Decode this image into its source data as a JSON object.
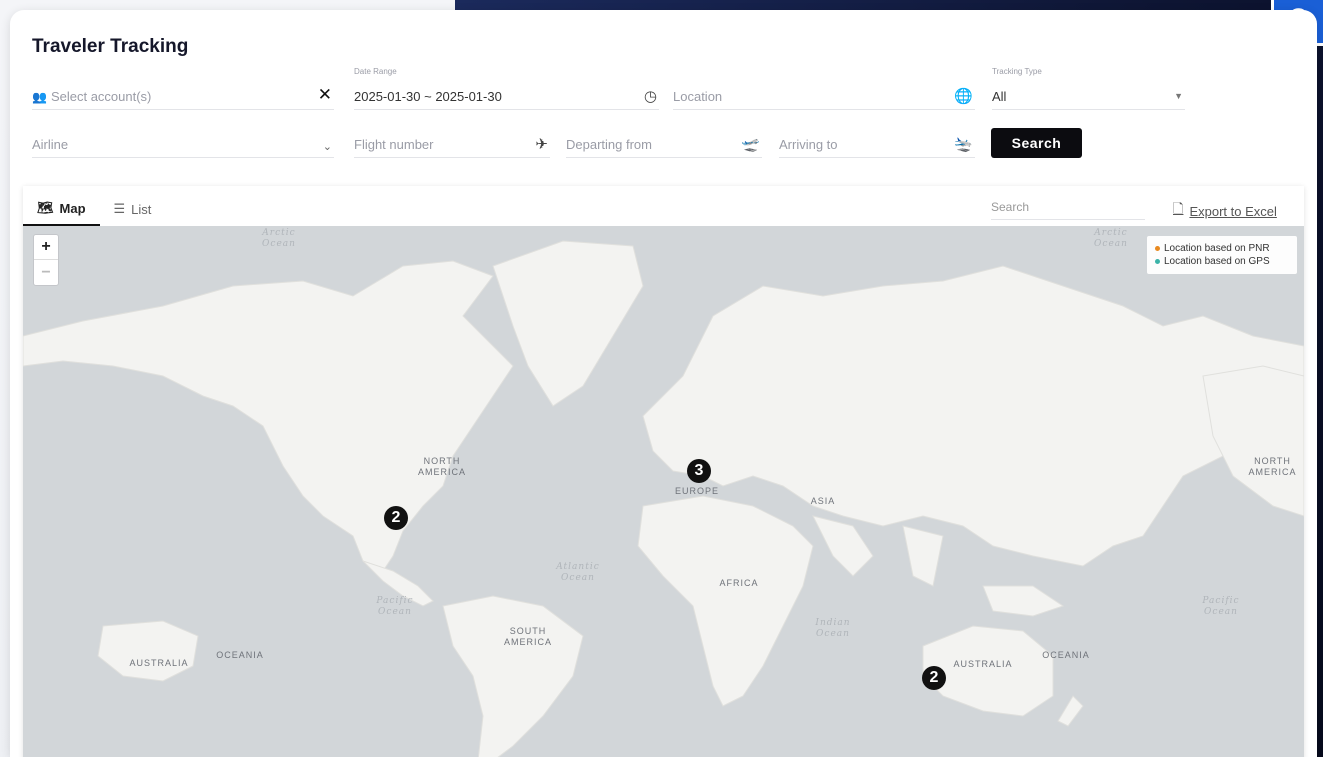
{
  "badge": "2",
  "page": {
    "title": "Traveler Tracking"
  },
  "filters": {
    "account_placeholder": "Select account(s)",
    "date_label": "Date Range",
    "date_value": "2025-01-30 ~ 2025-01-30",
    "location_placeholder": "Location",
    "tracking_label": "Tracking Type",
    "tracking_value": "All",
    "airline_placeholder": "Airline",
    "flight_placeholder": "Flight number",
    "departing_placeholder": "Departing from",
    "arriving_placeholder": "Arriving to",
    "search_button": "Search"
  },
  "map_panel": {
    "tab_map": "Map",
    "tab_list": "List",
    "search_placeholder": "Search",
    "export_label": "Export to Excel",
    "zoom_in": "+",
    "zoom_out": "−",
    "legend": [
      {
        "label": "Location based on PNR",
        "color": "#e8891f"
      },
      {
        "label": "Location based on GPS",
        "color": "#3bb3a8"
      }
    ],
    "labels": {
      "arctic_ocean": "Arctic Ocean",
      "north_america": "NORTH AMERICA",
      "europe": "EUROPE",
      "asia": "ASIA",
      "africa": "AFRICA",
      "atlantic_ocean": "Atlantic Ocean",
      "pacific_ocean": "Pacific Ocean",
      "indian_ocean": "Indian Ocean",
      "south_america": "SOUTH AMERICA",
      "australia": "AUSTRALIA",
      "oceania": "OCEANIA"
    },
    "clusters": [
      {
        "name": "cluster-north-america",
        "count": "2"
      },
      {
        "name": "cluster-europe",
        "count": "3"
      },
      {
        "name": "cluster-australia",
        "count": "2"
      }
    ]
  }
}
